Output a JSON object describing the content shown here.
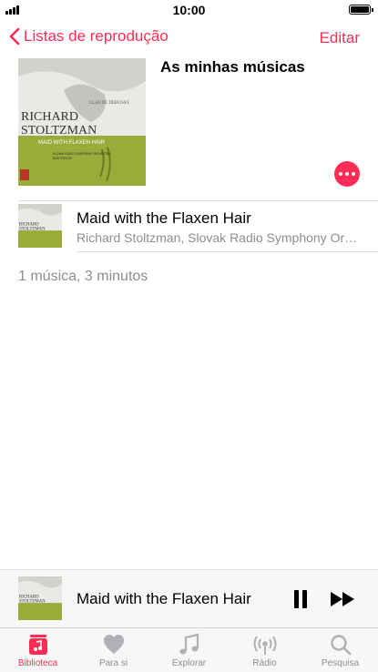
{
  "status_bar": {
    "time": "10:00"
  },
  "nav": {
    "back_label": "Listas de reprodução",
    "edit_label": "Editar"
  },
  "playlist": {
    "title": "As minhas músicas",
    "artwork": {
      "composer": "CLAUDE DEBUSSY",
      "artist_line1": "RICHARD",
      "artist_line2": "STOLTZMAN",
      "album": "MAID WITH FLAXEN HAIR",
      "credits_line1": "SLOVAK RADIO SYMPHONY ORCHESTRA",
      "credits_line2": "BOB TREVOR"
    }
  },
  "songs": [
    {
      "title": "Maid with the Flaxen Hair",
      "artist": "Richard Stoltzman, Slovak Radio Symphony Orchestra"
    }
  ],
  "summary": "1 música, 3 minutos",
  "now_playing": {
    "title": "Maid with the Flaxen Hair"
  },
  "tabs": [
    {
      "label": "Biblioteca",
      "icon": "library-icon",
      "active": true
    },
    {
      "label": "Para si",
      "icon": "heart-icon",
      "active": false
    },
    {
      "label": "Explorar",
      "icon": "music-note-icon",
      "active": false
    },
    {
      "label": "Rádio",
      "icon": "radio-icon",
      "active": false
    },
    {
      "label": "Pesquisa",
      "icon": "search-icon",
      "active": false
    }
  ],
  "colors": {
    "accent": "#ff2d55",
    "secondary_text": "#8e8e93",
    "artwork_green": "#9aab3a"
  }
}
